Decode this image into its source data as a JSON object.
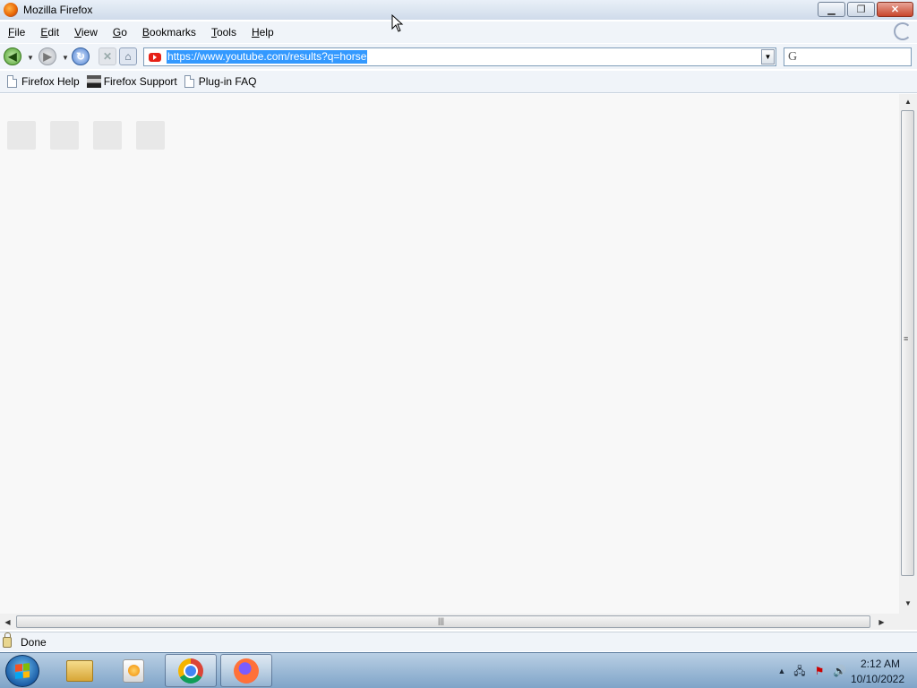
{
  "window": {
    "title": "Mozilla Firefox"
  },
  "menu": {
    "items": [
      "File",
      "Edit",
      "View",
      "Go",
      "Bookmarks",
      "Tools",
      "Help"
    ]
  },
  "toolbar": {
    "url": "https://www.youtube.com/results?q=horse",
    "search_engine_glyph": "G"
  },
  "bookmarks": {
    "items": [
      "Firefox Help",
      "Firefox Support",
      "Plug-in FAQ"
    ]
  },
  "statusbar": {
    "text": "Done"
  },
  "taskbar": {
    "apps": [
      "windows-explorer",
      "media-player",
      "google-chrome",
      "mozilla-firefox"
    ],
    "clock_time": "2:12 AM",
    "clock_date": "10/10/2022"
  },
  "colors": {
    "selection": "#3399ff",
    "youtube": "#e62117",
    "content_bg": "#f8f8f8"
  }
}
